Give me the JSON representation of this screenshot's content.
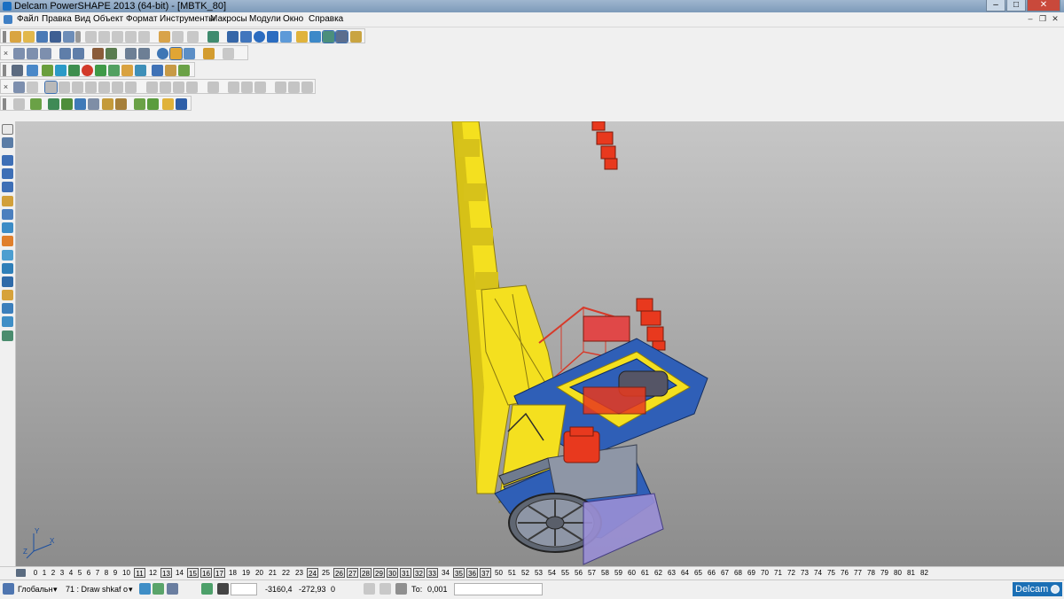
{
  "window": {
    "title": "Delcam PowerSHAPE 2013 (64-bit) - [MBTK_80]",
    "minimize_glyph": "–",
    "maximize_glyph": "□",
    "close_glyph": "✕"
  },
  "menu": {
    "items": [
      "Файл",
      "Правка",
      "Вид",
      "Объект",
      "Формат",
      "Инструменты",
      "Макросы",
      "Модули",
      "Окно",
      "Справка"
    ],
    "mdi_minimize": "–",
    "mdi_restore": "❐",
    "mdi_close": "✕"
  },
  "toolbar_close_glyph": "×",
  "levels": {
    "numbers": [
      "0",
      "1",
      "2",
      "3",
      "4",
      "5",
      "6",
      "7",
      "8",
      "9",
      "10",
      "11",
      "12",
      "13",
      "14",
      "15",
      "16",
      "17",
      "18",
      "19",
      "20",
      "21",
      "22",
      "23",
      "24",
      "25",
      "26",
      "27",
      "28",
      "29",
      "30",
      "31",
      "32",
      "33",
      "34",
      "35",
      "36",
      "37",
      "50",
      "51",
      "52",
      "53",
      "54",
      "55",
      "56",
      "57",
      "58",
      "59",
      "60",
      "61",
      "62",
      "63",
      "64",
      "65",
      "66",
      "67",
      "68",
      "69",
      "70",
      "71",
      "72",
      "73",
      "74",
      "75",
      "76",
      "77",
      "78",
      "79",
      "80",
      "81",
      "82"
    ],
    "active": [
      "11",
      "13",
      "15",
      "16",
      "17",
      "24",
      "26",
      "27",
      "28",
      "29",
      "30",
      "31",
      "32",
      "33",
      "35",
      "36",
      "37"
    ]
  },
  "status": {
    "workplane": "Глобальн",
    "workplane_arrow": "▾",
    "level": "71 : Draw shkaf o",
    "level_arrow": "▾",
    "x": "-3160,4",
    "y": "-272,93",
    "z": "0",
    "tol_label": "То:",
    "tolerance": "0,001"
  },
  "brand": {
    "label": "Delcam"
  },
  "colors": {
    "viewport_top": "#c6c6c6",
    "viewport_bottom": "#8c8c8c",
    "boom_yellow": "#f4e01f",
    "platform_blue": "#2f5fb7",
    "motor_red": "#e8391e",
    "steel_grey": "#8e96a6",
    "brand_blue": "#1b6fb5"
  },
  "triad_axes": [
    "Y",
    "X",
    "Z"
  ]
}
